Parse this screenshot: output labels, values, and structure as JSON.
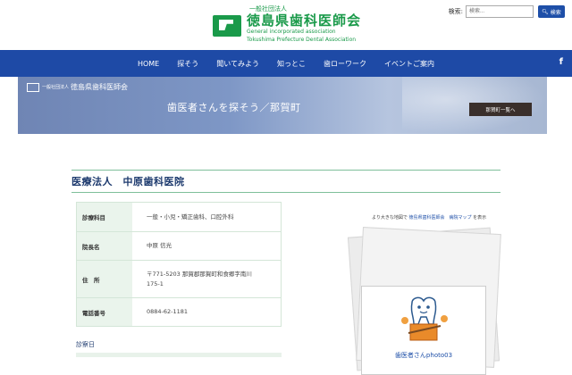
{
  "header": {
    "org_sub": "一般社団法人",
    "org_name": "徳島県歯科医師会",
    "org_en_1": "General incorporated association",
    "org_en_2": "Tokushima Prefecture Dental Association",
    "search_label": "検索:",
    "search_placeholder": "検索...",
    "search_button": "検索"
  },
  "nav": {
    "items": [
      "HOME",
      "探そう",
      "聞いてみよう",
      "知っとこ",
      "歯ローワーク",
      "イベントご案内"
    ],
    "fb": "f"
  },
  "banner": {
    "org_sub": "一般社団法人",
    "org_name": "徳島県歯科医師会",
    "title": "歯医者さんを探そう／那賀町",
    "button": "那賀町一覧へ"
  },
  "clinic": {
    "title": "医療法人　中原歯科医院",
    "rows": [
      {
        "label": "診療科目",
        "value": "一般・小児・矯正歯科、口腔外科"
      },
      {
        "label": "院長名",
        "value": "中原 信光"
      },
      {
        "label": "住　所",
        "value_1": "〒771-5203 那賀郡那賀町和食郷字南川",
        "value_2": "175-1"
      },
      {
        "label": "電話番号",
        "value": "0884-62-1181"
      }
    ],
    "hours_label": "診察日"
  },
  "side": {
    "map_prefix": "より大きな地図で ",
    "map_link": "徳島県歯科医師会　病院マップ",
    "map_suffix": " を表示",
    "photo_caption": "歯医者さんphoto03"
  },
  "colors": {
    "nav_blue": "#1e4aa6",
    "brand_green": "#1a9a4a",
    "title_navy": "#1d3a6e"
  }
}
